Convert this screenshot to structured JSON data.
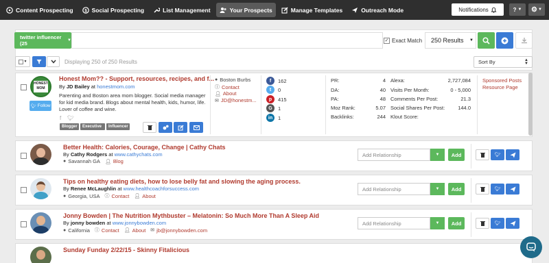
{
  "nav": {
    "items": [
      {
        "label": "Content Prospecting",
        "icon": "compass-icon"
      },
      {
        "label": "Social Prospecting",
        "icon": "dollar-icon"
      },
      {
        "label": "List Management",
        "icon": "wrench-icon"
      },
      {
        "label": "Your Prospects",
        "icon": "users-icon",
        "active": true
      },
      {
        "label": "Manage Templates",
        "icon": "pencil-icon"
      },
      {
        "label": "Outreach Mode",
        "icon": "send-icon"
      }
    ],
    "notifications_label": "Notifications",
    "help_label": "?"
  },
  "search": {
    "campaign_label": "twitter influencer (25",
    "query_value": "",
    "exact_match_label": "Exact Match",
    "exact_match_checked": true,
    "results_label": "250 Results"
  },
  "toolbar": {
    "displaying": "Displaying 250 of 250 Results",
    "sort_label": "Sort By"
  },
  "featured": {
    "title": "Honest Mom?? - Support, resources, recipes, and f...",
    "by_prefix": "By",
    "author": "JD Bailey",
    "at": "at",
    "site": "honestmom.com",
    "avatar_text_line1": "HONEST",
    "avatar_text_line2": "MOM",
    "follow_label": "Follow",
    "description": "Parenting and Boston area mom blogger. Social media manager for kid media brand. Blogs about mental health, kids, humor, life. Lover of coffee and wine.",
    "tags": [
      "Blogger",
      "Executive",
      "Influencer"
    ],
    "location": "Boston Burbs",
    "contact_label": "Contact",
    "about_label": "About",
    "email": "JD@honestm...",
    "social_counts": {
      "facebook": "162",
      "twitter": "0",
      "pinterest": "415",
      "googleplus": "1",
      "linkedin": "1"
    },
    "stats_left": [
      {
        "label": "PR:",
        "value": "4"
      },
      {
        "label": "DA:",
        "value": "40"
      },
      {
        "label": "PA:",
        "value": "48"
      },
      {
        "label": "Moz Rank:",
        "value": "5.07"
      },
      {
        "label": "Backlinks:",
        "value": "244"
      }
    ],
    "stats_right": [
      {
        "label": "Alexa:",
        "value": "2,727,084"
      },
      {
        "label": "Visits Per Month:",
        "value": "0 - 5,000"
      },
      {
        "label": "Comments Per Post:",
        "value": "21.3"
      },
      {
        "label": "Social Shares Per Post:",
        "value": "144.0"
      },
      {
        "label": "Klout Score:",
        "value": ""
      }
    ],
    "sponsored_label": "Sponsored Posts",
    "resource_label": "Resource Page"
  },
  "prospects": [
    {
      "title": "Better Health: Calories, Courage, Change | Cathy Chats",
      "author": "Cathy Rodgers",
      "site": "www.cathychats.com",
      "location": "Savannah GA",
      "link1": "Blog",
      "link2": "",
      "email": ""
    },
    {
      "title": "Tips on healthy eating diets, how to lose belly fat and slowing the aging process.",
      "author": "Renee McLaughlin",
      "site": "www.healthcoachforsuccess.com",
      "location": "Georgia, USA",
      "link1": "Contact",
      "link2": "About",
      "email": ""
    },
    {
      "title": "Jonny Bowden | The Nutrition Mythbuster – Melatonin: So Much More Than A Sleep Aid",
      "author": "jonny bowden",
      "site": "www.jonnybowden.com",
      "location": "California",
      "link1": "Contact",
      "link2": "About",
      "email": "jb@jonnybowden.com"
    },
    {
      "title": "Sunday Funday 2/22/15 - Skinny Fitalicious",
      "author": "",
      "site": "",
      "location": "",
      "link1": "",
      "link2": "",
      "email": ""
    }
  ],
  "relationship_placeholder": "Add Relationship",
  "add_label": "Add",
  "colors": {
    "nav_bg": "#2f2f2f",
    "green": "#5cb85c",
    "blue": "#3a7bd5",
    "title_red": "#b03a2e",
    "chat": "#1f6b8a"
  }
}
